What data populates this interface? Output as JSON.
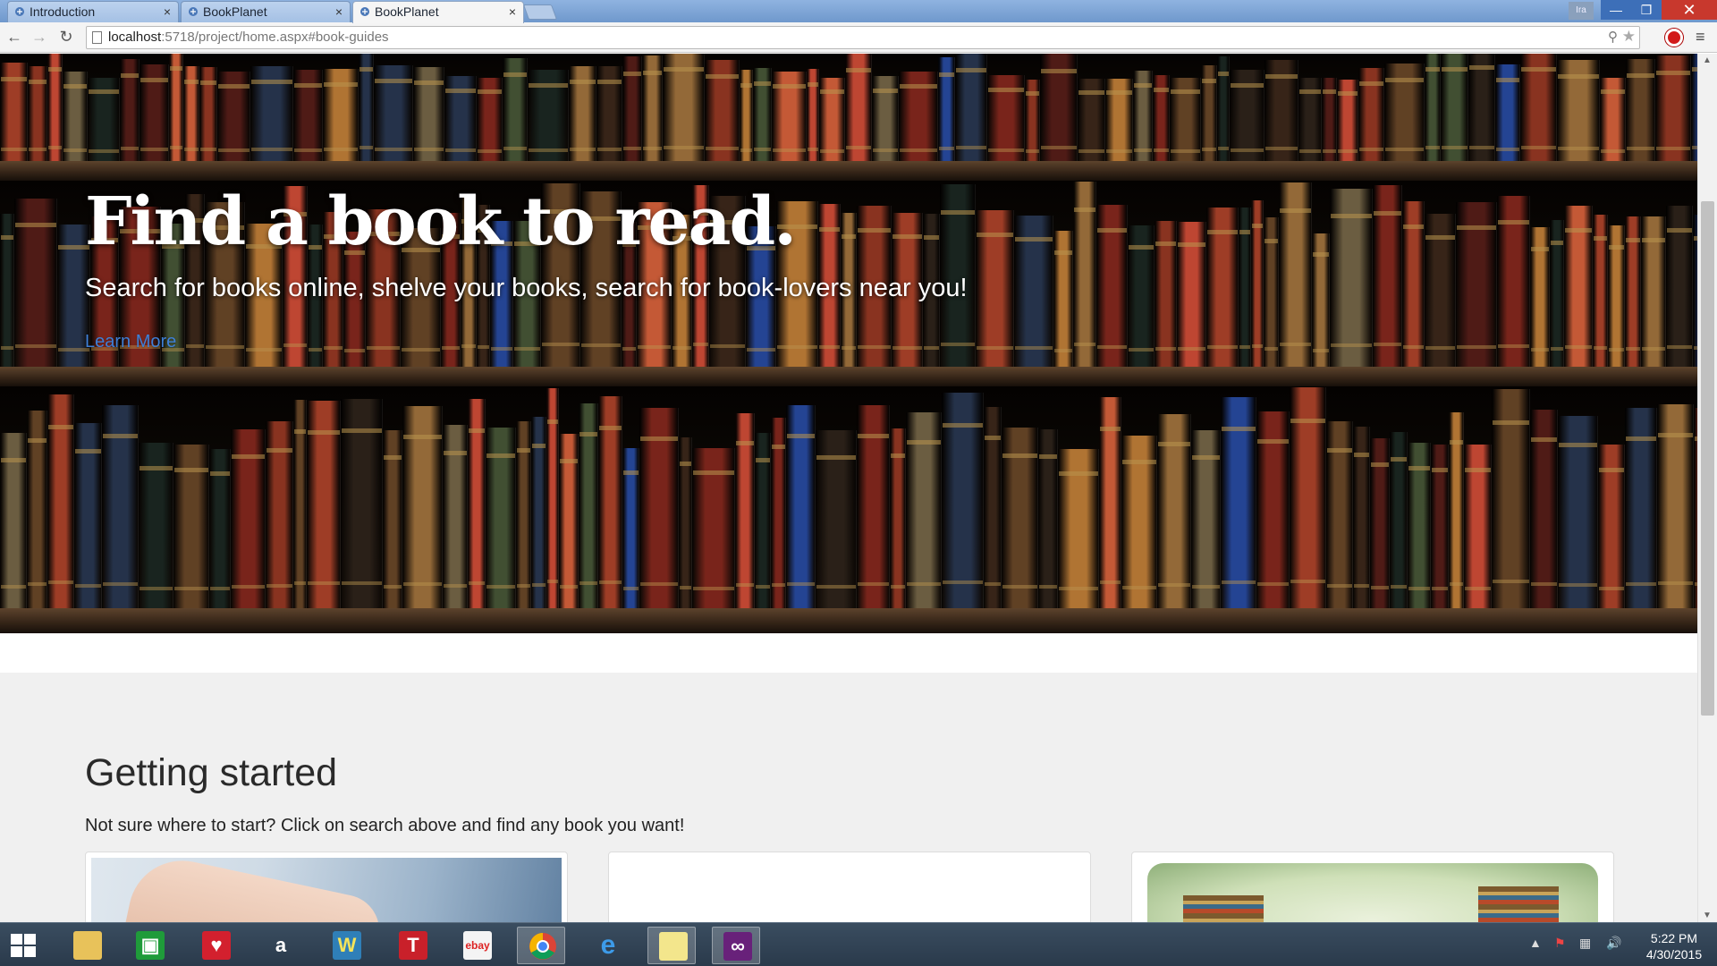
{
  "browser": {
    "tabs": [
      {
        "label": "Introduction",
        "active": false
      },
      {
        "label": "BookPlanet",
        "active": false
      },
      {
        "label": "BookPlanet",
        "active": true
      }
    ],
    "tab_close_glyph": "×",
    "user_badge": "Ira",
    "url_host": "localhost",
    "url_rest": ":5718/project/home.aspx#book-guides",
    "colors": {
      "tabstrip": "#7ea5d6",
      "close_button": "#c8382d"
    }
  },
  "hero": {
    "title": "Find a book to read.",
    "subtitle": "Search for books online, shelve your books, search for book-lovers near you!",
    "link": "Learn More",
    "link_color": "#3e7fd6"
  },
  "getting_started": {
    "title": "Getting started",
    "subtitle": "Not sure where to start? Click on search above and find any book you want!"
  },
  "taskbar": {
    "apps": [
      {
        "name": "file-explorer-icon"
      },
      {
        "name": "store-icon"
      },
      {
        "name": "iheartradio-icon"
      },
      {
        "name": "amazon-icon",
        "glyph": "a"
      },
      {
        "name": "games-icon",
        "glyph": "W"
      },
      {
        "name": "t-app-icon",
        "glyph": "T"
      },
      {
        "name": "ebay-icon",
        "glyph": "ebay"
      },
      {
        "name": "chrome-icon"
      },
      {
        "name": "internet-explorer-icon",
        "glyph": "e"
      },
      {
        "name": "sticky-notes-icon"
      },
      {
        "name": "visual-studio-icon"
      }
    ],
    "clock_time": "5:22 PM",
    "clock_date": "4/30/2015"
  }
}
